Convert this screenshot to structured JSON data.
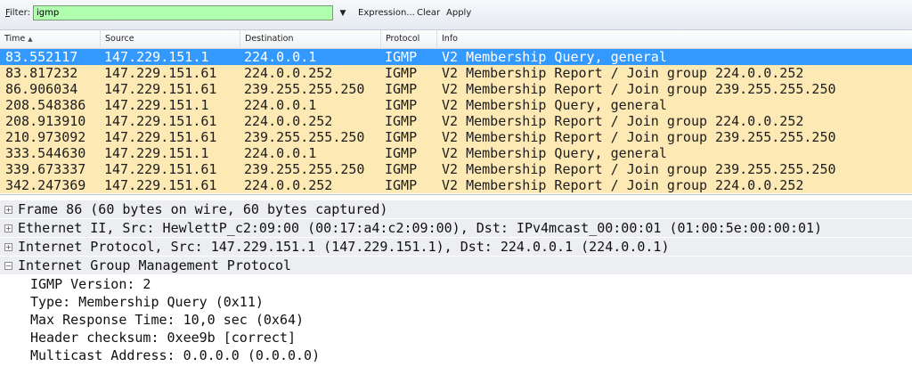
{
  "filterbar": {
    "label_prefix": "F",
    "label_rest": "ilter:",
    "value": "igmp",
    "dropdown_icon": "▼",
    "expression_label": "Expression...",
    "clear_label": "Clear",
    "apply_label": "Apply"
  },
  "packet_list": {
    "columns": [
      {
        "label": "Time",
        "sort_icon": "▲"
      },
      {
        "label": "Source"
      },
      {
        "label": "Destination"
      },
      {
        "label": "Protocol"
      },
      {
        "label": "Info"
      }
    ],
    "rows": [
      {
        "time": "83.552117",
        "source": "147.229.151.1",
        "destination": "224.0.0.1",
        "protocol": "IGMP",
        "info": "V2 Membership Query, general",
        "selected": true
      },
      {
        "time": "83.817232",
        "source": "147.229.151.61",
        "destination": "224.0.0.252",
        "protocol": "IGMP",
        "info": "V2 Membership Report / Join group 224.0.0.252"
      },
      {
        "time": "86.906034",
        "source": "147.229.151.61",
        "destination": "239.255.255.250",
        "protocol": "IGMP",
        "info": "V2 Membership Report / Join group 239.255.255.250"
      },
      {
        "time": "208.548386",
        "source": "147.229.151.1",
        "destination": "224.0.0.1",
        "protocol": "IGMP",
        "info": "V2 Membership Query, general"
      },
      {
        "time": "208.913910",
        "source": "147.229.151.61",
        "destination": "224.0.0.252",
        "protocol": "IGMP",
        "info": "V2 Membership Report / Join group 224.0.0.252"
      },
      {
        "time": "210.973092",
        "source": "147.229.151.61",
        "destination": "239.255.255.250",
        "protocol": "IGMP",
        "info": "V2 Membership Report / Join group 239.255.255.250"
      },
      {
        "time": "333.544630",
        "source": "147.229.151.1",
        "destination": "224.0.0.1",
        "protocol": "IGMP",
        "info": "V2 Membership Query, general"
      },
      {
        "time": "339.673337",
        "source": "147.229.151.61",
        "destination": "239.255.255.250",
        "protocol": "IGMP",
        "info": "V2 Membership Report / Join group 239.255.255.250"
      },
      {
        "time": "342.247369",
        "source": "147.229.151.61",
        "destination": "224.0.0.252",
        "protocol": "IGMP",
        "info": "V2 Membership Report / Join group 224.0.0.252"
      }
    ]
  },
  "details": {
    "collapsed_icon": "+",
    "expanded_icon": "−",
    "frame": "Frame 86 (60 bytes on wire, 60 bytes captured)",
    "ethernet": "Ethernet II, Src: HewlettP_c2:09:00 (00:17:a4:c2:09:00), Dst: IPv4mcast_00:00:01 (01:00:5e:00:00:01)",
    "ip": "Internet Protocol, Src: 147.229.151.1 (147.229.151.1), Dst: 224.0.0.1 (224.0.0.1)",
    "igmp": "Internet Group Management Protocol",
    "igmp_fields": [
      "IGMP Version: 2",
      "Type: Membership Query (0x11)",
      "Max Response Time: 10,0 sec (0x64)",
      "Header checksum: 0xee9b [correct]",
      "Multicast Address: 0.0.0.0 (0.0.0.0)"
    ]
  },
  "colors": {
    "row_background": "#fce9b4",
    "selected_row": "#3399ff",
    "filter_valid": "#afffaf"
  }
}
